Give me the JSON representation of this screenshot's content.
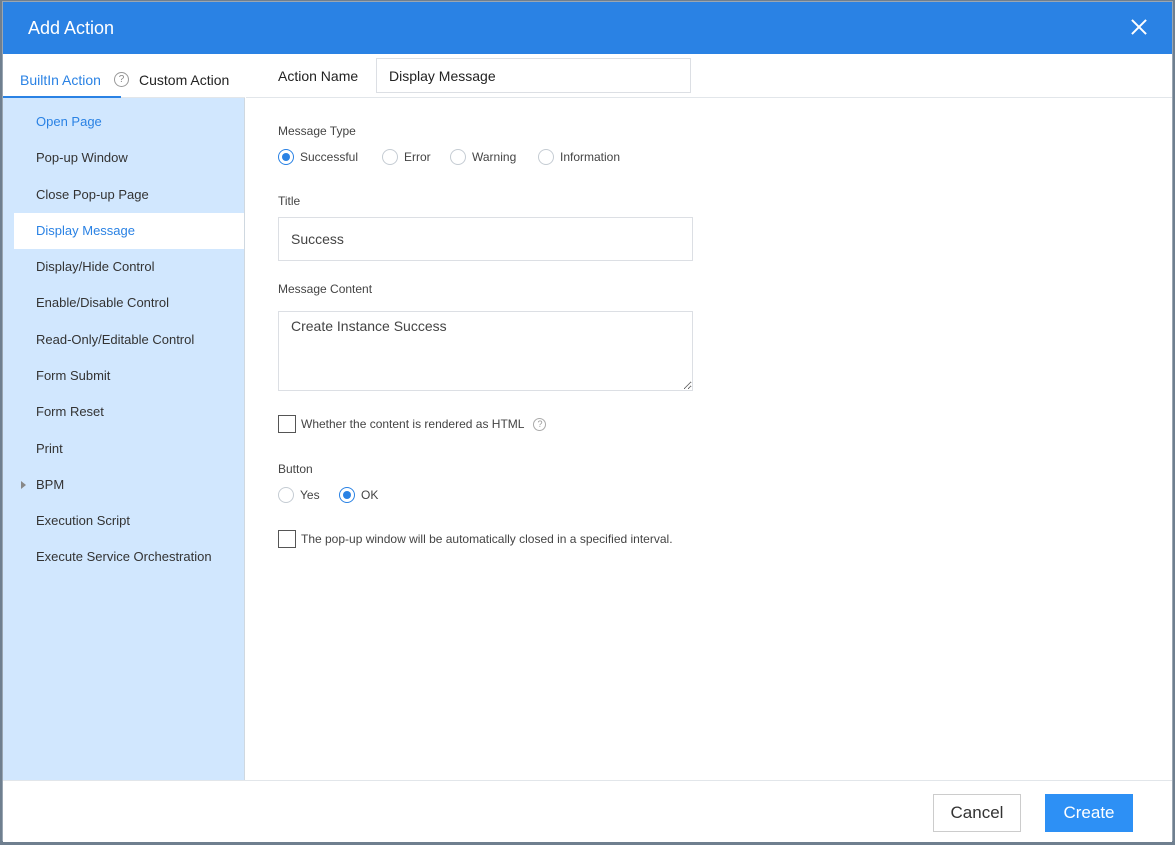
{
  "dialog": {
    "title": "Add Action"
  },
  "tabs": {
    "builtin": "BuiltIn Action",
    "help": "?",
    "custom": "Custom Action"
  },
  "actions": [
    "Open Page",
    "Pop-up Window",
    "Close Pop-up Page",
    "Display Message",
    "Display/Hide Control",
    "Enable/Disable Control",
    "Read-Only/Editable Control",
    "Form Submit",
    "Form Reset",
    "Print",
    "BPM",
    "Execution Script",
    "Execute Service Orchestration"
  ],
  "selected_action": "Display Message",
  "form": {
    "action_name_label": "Action Name",
    "action_name_value": "Display Message",
    "message_type_label": "Message Type",
    "message_types": [
      "Successful",
      "Error",
      "Warning",
      "Information"
    ],
    "message_type_selected": "Successful",
    "title_label": "Title",
    "title_value": "Success",
    "content_label": "Message Content",
    "content_value": "Create Instance Success",
    "html_checkbox_label": "Whether the content is rendered as HTML",
    "button_label": "Button",
    "button_options": [
      "Yes",
      "OK"
    ],
    "button_selected": "OK",
    "autoclose_label": "The pop-up window will be automatically closed in a specified interval."
  },
  "footer": {
    "cancel": "Cancel",
    "create": "Create"
  },
  "colors": {
    "accent": "#2a82e4",
    "sidebar_bg": "#d1e7fe",
    "create_button": "#2d90f5"
  }
}
